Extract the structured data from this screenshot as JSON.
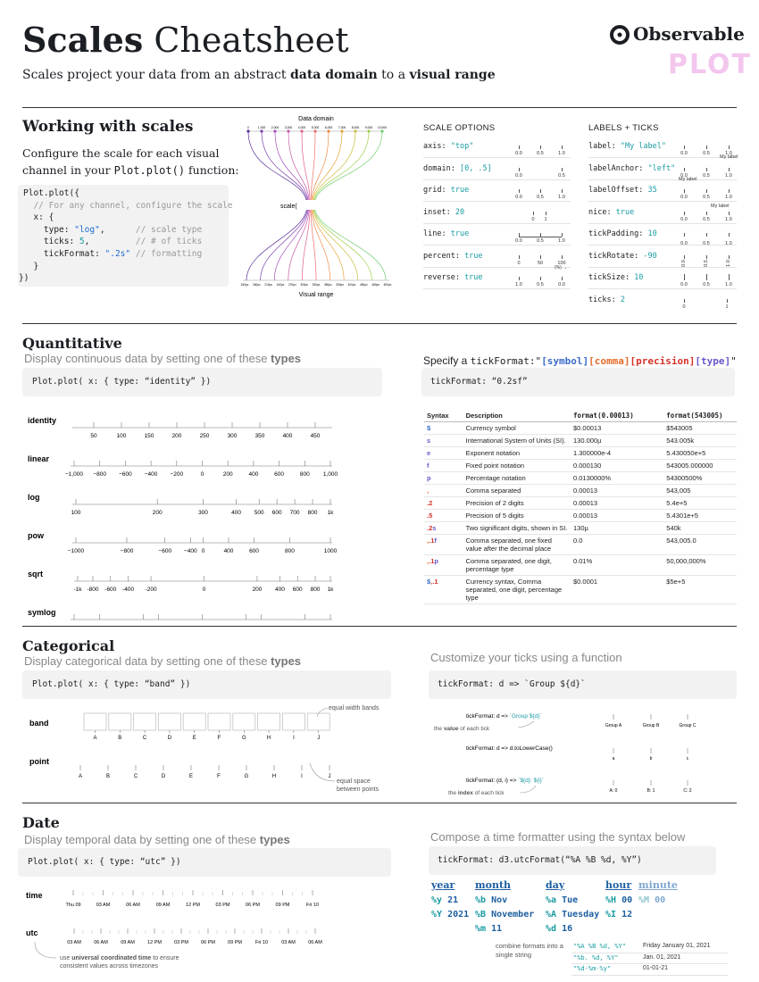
{
  "header": {
    "title_bold": "Scales",
    "title_rest": "Cheatsheet",
    "subtitle_pre": "Scales project your data from an abstract ",
    "subtitle_b1": "data domain",
    "subtitle_mid": " to a ",
    "subtitle_b2": "visual range",
    "brand": "Observable",
    "brand_sub": "PLOT"
  },
  "working": {
    "title": "Working with scales",
    "desc1": "Configure the scale for each visual",
    "desc2_pre": "channel in your ",
    "desc2_code": "Plot.plot()",
    "desc2_post": " function:",
    "code": [
      "Plot.plot({",
      "  // For any channel, configure the scale",
      "  x: {",
      "    type: \"log\",      // scale type",
      "    ticks: 5,         // # of ticks",
      "    tickFormat: \".2s\" // formatting",
      "  }",
      "})"
    ],
    "diagram_top": "Data domain",
    "diagram_mid": "scale(",
    "diagram_bottom": "Visual range",
    "domain_ticks": [
      "0",
      "1,000",
      "2,000",
      "3,000",
      "4,000",
      "5,000",
      "6,000",
      "7,000",
      "8,000",
      "9,000",
      "10,000"
    ],
    "range_ticks": [
      "150px",
      "180px",
      "210px",
      "240px",
      "270px",
      "300px",
      "330px",
      "360px",
      "390px",
      "420px",
      "450px",
      "480px",
      "500px"
    ]
  },
  "options": {
    "title": "SCALE OPTIONS",
    "items": [
      {
        "key": "axis: ",
        "val": "\"top\"",
        "ticks": [
          "0.0",
          "0.5",
          "1.0"
        ]
      },
      {
        "key": "domain: ",
        "val": "[0, .5]",
        "ticks": [
          "0.0",
          "0.5"
        ]
      },
      {
        "key": "grid: ",
        "val": "true",
        "ticks": [
          "0.0",
          "0.5",
          "1.0"
        ]
      },
      {
        "key": "inset: ",
        "val": "20",
        "ticks": [
          "0",
          "1"
        ]
      },
      {
        "key": "line: ",
        "val": "true",
        "ticks": [
          "0.0",
          "0.5",
          "1.0"
        ]
      },
      {
        "key": "percent: ",
        "val": "true",
        "ticks": [
          "0",
          "50",
          "100"
        ]
      },
      {
        "key": "reverse: ",
        "val": "true",
        "ticks": [
          "1.0",
          "0.5",
          "0.0"
        ]
      }
    ],
    "percent_unit": "(%) →"
  },
  "labels": {
    "title": "LABELS + TICKS",
    "items": [
      {
        "key": "label: ",
        "val": "\"My label\"",
        "ticks": [
          "0.0",
          "0.5",
          "1.0"
        ],
        "extra": "My label"
      },
      {
        "key": "labelAnchor: ",
        "val": "\"left\"",
        "ticks": [
          "0.0",
          "0.5",
          "1.0"
        ],
        "extra": "My label"
      },
      {
        "key": "labelOffset: ",
        "val": "35",
        "ticks": [
          "0.0",
          "0.5",
          "1.0"
        ],
        "extra": "My label"
      },
      {
        "key": "nice: ",
        "val": "true",
        "ticks": [
          "0.0",
          "0.5",
          "1.0"
        ],
        "extra": ""
      },
      {
        "key": "tickPadding: ",
        "val": "10",
        "ticks": [
          "0.0",
          "0.5",
          "1.0"
        ],
        "extra": ""
      },
      {
        "key": "tickRotate: ",
        "val": "-90",
        "ticks": [
          "0.0",
          "0.5",
          "1.0"
        ],
        "extra": ""
      },
      {
        "key": "tickSize: ",
        "val": "10",
        "ticks": [
          "0.0",
          "0.5",
          "1.0"
        ],
        "extra": ""
      },
      {
        "key": "ticks: ",
        "val": "2",
        "ticks": [
          "0",
          "1"
        ],
        "extra": ""
      }
    ]
  },
  "quant": {
    "title": "Quantitative",
    "sub_pre": "Display continuous data by setting one of these ",
    "sub_b": "types",
    "code": "Plot.plot( x: { type: “identity” })",
    "axes": [
      {
        "name": "identity",
        "ticks": [
          "50",
          "100",
          "150",
          "200",
          "250",
          "300",
          "350",
          "400",
          "450"
        ]
      },
      {
        "name": "linear",
        "ticks": [
          "−1,000",
          "−800",
          "−600",
          "−400",
          "−200",
          "0",
          "200",
          "400",
          "600",
          "800",
          "1,000"
        ]
      },
      {
        "name": "log",
        "ticks": [
          "100",
          "200",
          "300",
          "400",
          "500",
          "600",
          "700",
          "800",
          "1k"
        ]
      },
      {
        "name": "pow",
        "ticks": [
          "−1000",
          "−800",
          "−600",
          "−400",
          "0",
          "400",
          "600",
          "800",
          "1000"
        ]
      },
      {
        "name": "sqrt",
        "ticks": [
          "-1k",
          "-800",
          "-600",
          "-400",
          "-200",
          "0",
          "200",
          "400",
          "600",
          "800",
          "1k"
        ]
      },
      {
        "name": "symlog",
        "ticks": [
          "−1,000",
          "−500",
          "−100",
          "−50",
          "0",
          "50",
          "100",
          "500",
          "1,000"
        ]
      }
    ],
    "fmt_title_pre": "Specify a ",
    "fmt_title_code": "tickFormat:\"",
    "fmt_sym": "[symbol]",
    "fmt_com": "[comma]",
    "fmt_pre": "[precision]",
    "fmt_typ": "[type]",
    "fmt_end": "\"",
    "fmt_code": "tickFormat: “0.2sf”",
    "table_head": [
      "Syntax",
      "Description",
      "format(0.00013)",
      "format(543005)"
    ],
    "table_rows": [
      [
        "$",
        "Currency symbol",
        "$0.00013",
        "$543005"
      ],
      [
        "s",
        "International System of Units (SI).",
        "130.000µ",
        "543.005k"
      ],
      [
        "e",
        "Exponent notation",
        "1.300000e-4",
        "5.430050e+5"
      ],
      [
        "f",
        "Fixed point notation",
        "0.000130",
        "543005.000000"
      ],
      [
        "p",
        "Percentage notation",
        "0.0130000%",
        "54300500%"
      ],
      [
        ",",
        "Comma separated",
        "0.00013",
        "543,005"
      ],
      [
        ".2",
        "Precision of 2 digits",
        "0.00013",
        "5.4e+5"
      ],
      [
        ".5",
        "Precision of 5 digits",
        "0.00013",
        "5.4301e+5"
      ],
      [
        ".2s",
        "Two significant digits, shown in SI.",
        "130µ",
        "540k"
      ],
      [
        ",.1f",
        "Comma separated, one fixed value after the decimal place",
        "0.0",
        "543,005.0"
      ],
      [
        ",.1p",
        "Comma separated, one digit, percentage type",
        "0.01%",
        "50,000,000%"
      ],
      [
        "$,.1",
        "Currency syntax, Comma separated, one digit, percentage type",
        "$0.0001",
        "$5e+5"
      ]
    ]
  },
  "cat": {
    "title": "Categorical",
    "sub_pre": "Display categorical data by setting one of these ",
    "sub_b": "types",
    "code": "Plot.plot( x: { type: “band” })",
    "band": "band",
    "point": "point",
    "letters": [
      "A",
      "B",
      "C",
      "D",
      "E",
      "F",
      "G",
      "H",
      "I",
      "J"
    ],
    "note_band": "equal width bands",
    "note_point1": "equal space",
    "note_point2": "between points",
    "fn_title": "Customize your ticks using a function",
    "fn_code": "tickFormat: d => `Group ${d}`",
    "ex1_code_a": "tickFormat: d => ",
    "ex1_code_b": "`Group ${d}`",
    "ex1_note_pre": "the ",
    "ex1_note_b": "value",
    "ex1_note_post": " of each tick",
    "ex1_ticks": [
      "Group A",
      "Group B",
      "Group C"
    ],
    "ex2_code": "tickFormat: d => d.toLowerCase()",
    "ex2_ticks": [
      "a",
      "b",
      "c"
    ],
    "ex3_code_a": "tickFormat: (d, i) => ",
    "ex3_code_b": "`${d}: ${i}`",
    "ex3_note_pre": "the ",
    "ex3_note_b": "index",
    "ex3_note_post": " of each tick",
    "ex3_ticks": [
      "A: 0",
      "B: 1",
      "C: 2"
    ]
  },
  "date": {
    "title": "Date",
    "sub_pre": "Display temporal data by setting one of these ",
    "sub_b": "types",
    "code": "Plot.plot( x: { type: “utc” })",
    "time": "time",
    "utc": "utc",
    "time_ticks": [
      "Thu 09",
      "03 AM",
      "06 AM",
      "09 AM",
      "12 PM",
      "03 PM",
      "06 PM",
      "09 PM",
      "Fri 10"
    ],
    "utc_ticks": [
      "03 AM",
      "06 AM",
      "09 AM",
      "12 PM",
      "03 PM",
      "06 PM",
      "09 PM",
      "Fri 10",
      "03 AM",
      "06 AM"
    ],
    "utc_note_pre": "use ",
    "utc_note_b": "universal coordinated time",
    "utc_note_post": " to ensure",
    "utc_note2": "consistent values across timezones",
    "fmt_title": "Compose a time formatter using the syntax below",
    "fmt_code": "tickFormat: d3.utcFormat(“%A %B %d, %Y”)",
    "cols": [
      {
        "head": "year",
        "items": [
          "%y 21",
          "%Y 2021"
        ]
      },
      {
        "head": "month",
        "items": [
          "%b Nov",
          "%B November",
          "%m 11"
        ]
      },
      {
        "head": "day",
        "items": [
          "%a Tue",
          "%A Tuesday",
          "%d 16"
        ]
      },
      {
        "head": "hour",
        "items": [
          "%H 00",
          "%I 12"
        ]
      },
      {
        "head": "minute",
        "items": [
          "%M 00"
        ]
      }
    ],
    "combine1": "combine formats into a",
    "combine2": "single string",
    "combos": [
      {
        "fmt": "\"%A %B %d, %Y\"",
        "out": "Friday January 01, 2021"
      },
      {
        "fmt": "\"%b. %d, %Y\"",
        "out": "Jan. 01, 2021"
      },
      {
        "fmt": "\"%d-%m-%y\"",
        "out": "01-01-21"
      }
    ]
  }
}
